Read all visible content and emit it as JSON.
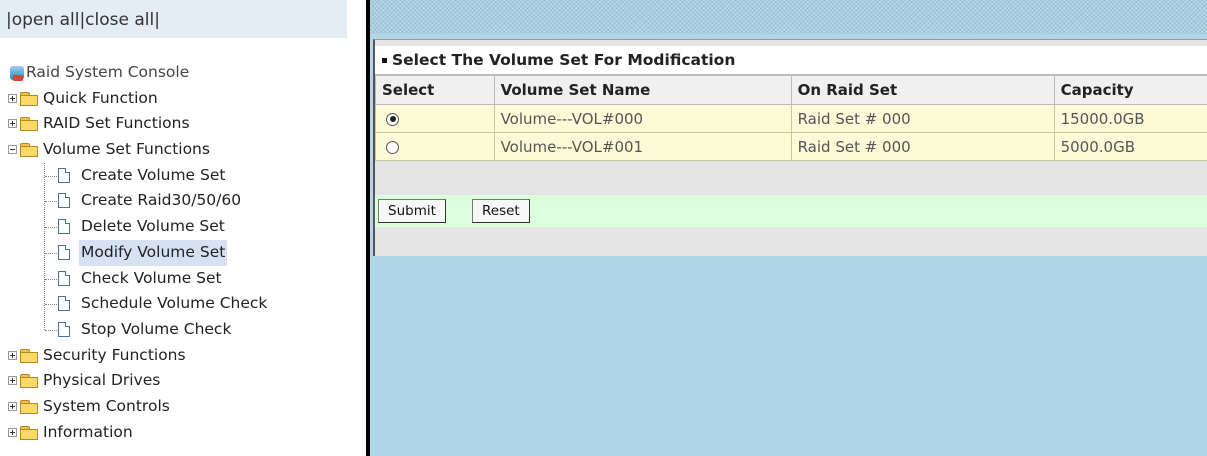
{
  "topbar": {
    "open_all": "open all",
    "close_all": "close all",
    "sep": "|"
  },
  "tree": {
    "root": "Raid System Console",
    "items": [
      {
        "label": "Quick Function",
        "expanded": false
      },
      {
        "label": "RAID Set Functions",
        "expanded": false
      },
      {
        "label": "Volume Set Functions",
        "expanded": true,
        "children": [
          "Create Volume Set",
          "Create Raid30/50/60",
          "Delete Volume Set",
          "Modify Volume Set",
          "Check Volume Set",
          "Schedule Volume Check",
          "Stop Volume Check"
        ]
      },
      {
        "label": "Security Functions",
        "expanded": false
      },
      {
        "label": "Physical Drives",
        "expanded": false
      },
      {
        "label": "System Controls",
        "expanded": false
      },
      {
        "label": "Information",
        "expanded": false
      }
    ],
    "selected": "Modify Volume Set"
  },
  "panel": {
    "title": "Select The Volume Set For Modification",
    "columns": [
      "Select",
      "Volume Set Name",
      "On Raid Set",
      "Capacity"
    ],
    "rows": [
      {
        "selected": true,
        "name": "Volume---VOL#000",
        "raid_set": "Raid Set # 000",
        "capacity": "15000.0GB"
      },
      {
        "selected": false,
        "name": "Volume---VOL#001",
        "raid_set": "Raid Set # 000",
        "capacity": "5000.0GB"
      }
    ],
    "submit_label": "Submit",
    "reset_label": "Reset"
  }
}
